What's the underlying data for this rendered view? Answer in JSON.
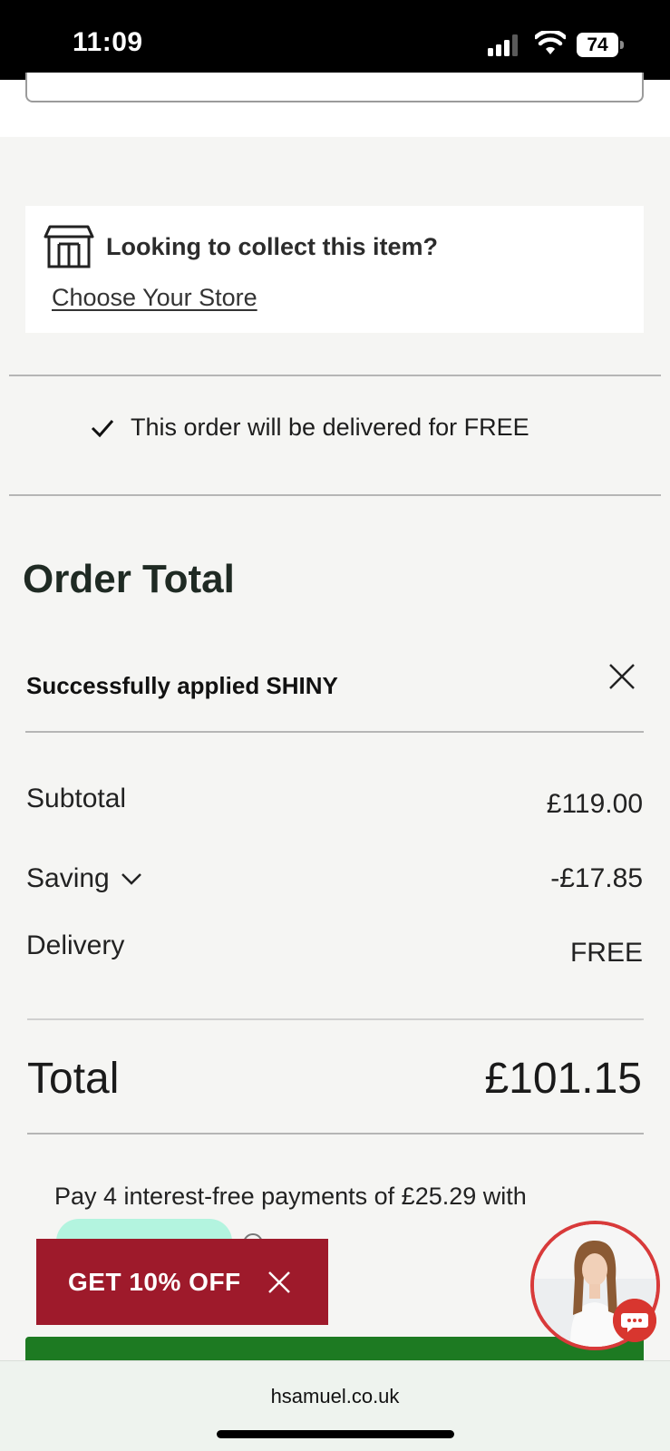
{
  "status_bar": {
    "time": "11:09",
    "battery": "74"
  },
  "store": {
    "title": "Looking to collect this item?",
    "link": "Choose Your Store",
    "icon": "store-icon"
  },
  "delivery": {
    "note": "This order will be delivered for FREE",
    "icon": "check-icon"
  },
  "order": {
    "title": "Order Total",
    "applied_message": "Successfully applied SHINY",
    "rows": {
      "subtotal_label": "Subtotal",
      "subtotal_value": "£119.00",
      "saving_label": "Saving",
      "saving_value": "-£17.85",
      "delivery_label": "Delivery",
      "delivery_value": "FREE"
    },
    "total_label": "Total",
    "total_value": "£101.15",
    "installments": "Pay 4 interest-free payments of £25.29 with"
  },
  "promo": {
    "label": "GET 10% OFF"
  },
  "browser": {
    "url": "hsamuel.co.uk"
  },
  "colors": {
    "page_bg": "#f5f5f3",
    "promo_bg": "#9e1a2b",
    "checkout_green": "#1d7a22",
    "klarna_pill": "#b3f4df",
    "chat_red": "#d83a3a"
  }
}
